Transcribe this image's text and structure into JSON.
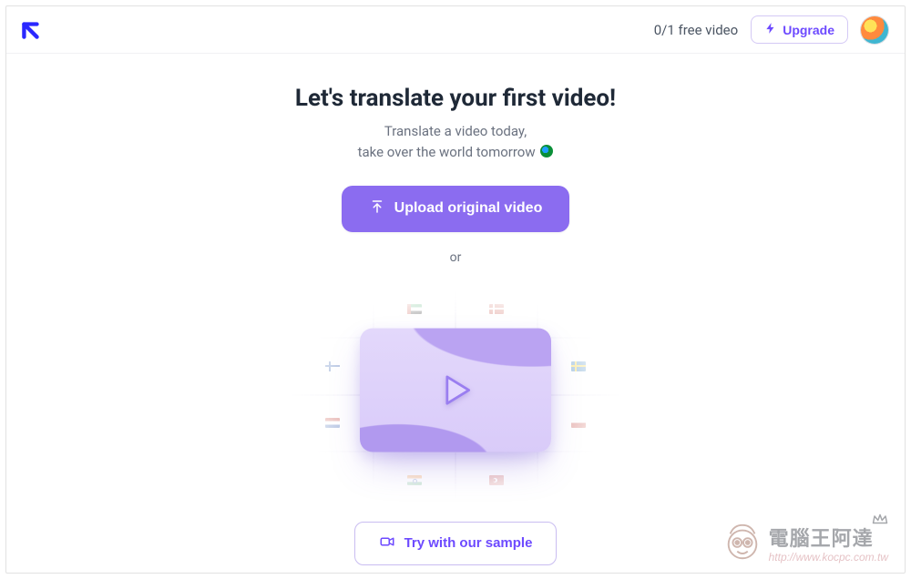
{
  "header": {
    "quota_text": "0/1 free video",
    "upgrade_label": "Upgrade"
  },
  "hero": {
    "title": "Let's translate your first video!",
    "subtitle_line1": "Translate a video today,",
    "subtitle_line2": "take over the world tomorrow",
    "upload_label": "Upload original video",
    "or_label": "or",
    "sample_label": "Try with our sample"
  },
  "watermark": {
    "title_cn": "電腦王阿達",
    "url": "http://www.kocpc.com.tw"
  },
  "colors": {
    "primary": "#8b6cf0",
    "primary_text": "#6d4aff",
    "logo": "#2a27ff"
  }
}
